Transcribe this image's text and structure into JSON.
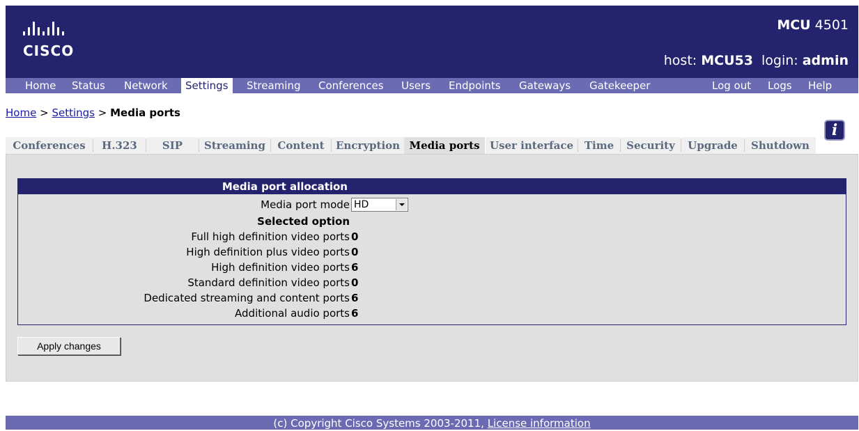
{
  "header": {
    "logo_text": "CISCO",
    "product_name": "MCU",
    "product_model": "4501",
    "host_label": "host:",
    "host_value": "MCU53",
    "login_label": "login:",
    "login_value": "admin",
    "background_color": "#24246e"
  },
  "nav": {
    "items": [
      {
        "label": "Home"
      },
      {
        "label": "Status"
      },
      {
        "label": "Network"
      },
      {
        "label": "Settings",
        "active": true
      },
      {
        "label": "Streaming"
      },
      {
        "label": "Conferences"
      },
      {
        "label": "Users"
      },
      {
        "label": "Endpoints"
      },
      {
        "label": "Gateways"
      },
      {
        "label": "Gatekeeper"
      }
    ],
    "right_items": [
      {
        "label": "Log out"
      },
      {
        "label": "Logs"
      },
      {
        "label": "Help"
      }
    ],
    "color": "#6b6bb3"
  },
  "breadcrumb": {
    "home": "Home",
    "sep1": ">",
    "settings": "Settings",
    "sep2": ">",
    "current": "Media ports"
  },
  "info_icon": {
    "glyph": "i",
    "icon": "info-icon"
  },
  "subtabs": [
    {
      "label": "Conferences"
    },
    {
      "label": "H.323"
    },
    {
      "label": "SIP"
    },
    {
      "label": "Streaming"
    },
    {
      "label": "Content"
    },
    {
      "label": "Encryption"
    },
    {
      "label": "Media ports",
      "active": true
    },
    {
      "label": "User interface"
    },
    {
      "label": "Time"
    },
    {
      "label": "Security"
    },
    {
      "label": "Upgrade"
    },
    {
      "label": "Shutdown"
    }
  ],
  "panel": {
    "title": "Media port allocation",
    "mode_label": "Media port mode",
    "mode_value": "HD",
    "selected_heading": "Selected option",
    "rows": [
      {
        "label": "Full high definition video ports",
        "value": "0"
      },
      {
        "label": "High definition plus video ports",
        "value": "0"
      },
      {
        "label": "High definition video ports",
        "value": "6"
      },
      {
        "label": "Standard definition video ports",
        "value": "0"
      },
      {
        "label": "Dedicated streaming and content ports",
        "value": "6"
      },
      {
        "label": "Additional audio ports",
        "value": "6"
      }
    ]
  },
  "apply_button": "Apply changes",
  "footer": {
    "text": "(c) Copyright Cisco Systems 2003-2011,",
    "link": "License information"
  }
}
